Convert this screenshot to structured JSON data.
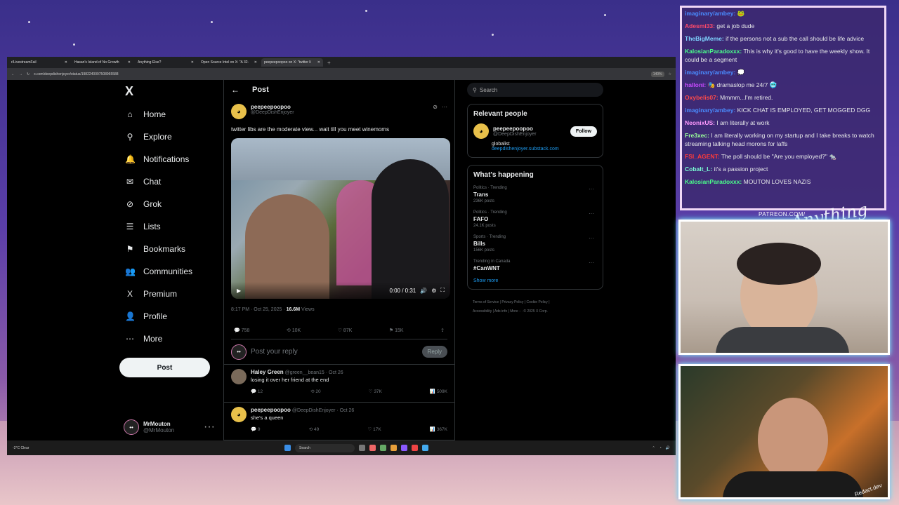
{
  "browser": {
    "tabs": [
      {
        "label": "r/LivestreamFail",
        "active": false
      },
      {
        "label": "Hasan's Island of No Growth",
        "active": false
      },
      {
        "label": "Anything Else?",
        "active": false
      },
      {
        "label": "Open Source Intel on X: \"A 32-",
        "active": false
      },
      {
        "label": "peepeepoopoo on X: \"twitter li",
        "active": true
      }
    ],
    "url": "x.com/deepdishenjoyer/status/1982240097508965588",
    "zoom": "140%"
  },
  "nav": {
    "logo": "X",
    "items": [
      {
        "label": "Home",
        "icon": "home-icon",
        "glyph": "⌂"
      },
      {
        "label": "Explore",
        "icon": "search-icon",
        "glyph": "⚲"
      },
      {
        "label": "Notifications",
        "icon": "bell-icon",
        "glyph": "🔔"
      },
      {
        "label": "Chat",
        "icon": "mail-icon",
        "glyph": "✉"
      },
      {
        "label": "Grok",
        "icon": "grok-icon",
        "glyph": "⊘"
      },
      {
        "label": "Lists",
        "icon": "list-icon",
        "glyph": "☰"
      },
      {
        "label": "Bookmarks",
        "icon": "bookmark-icon",
        "glyph": "⚑"
      },
      {
        "label": "Communities",
        "icon": "people-icon",
        "glyph": "👥"
      },
      {
        "label": "Premium",
        "icon": "x-premium-icon",
        "glyph": "X"
      },
      {
        "label": "Profile",
        "icon": "profile-icon",
        "glyph": "👤"
      },
      {
        "label": "More",
        "icon": "more-circle-icon",
        "glyph": "⋯"
      }
    ],
    "post_label": "Post",
    "account_name": "MrMouton",
    "account_handle": "@MrMouton"
  },
  "main": {
    "header_title": "Post",
    "tweet": {
      "name": "peepeepoopoo",
      "handle": "@DeepDishEnjoyer",
      "text": "twitter libs are the moderate view... wait till you meet winemoms",
      "video_time": "0:00 / 0:31",
      "time": "8:17 PM · Oct 25, 2025 ·",
      "views_count": "16.6M",
      "views_label": "Views",
      "replies": "758",
      "reposts": "10K",
      "likes": "87K",
      "bookmarks": "15K"
    },
    "reply_placeholder": "Post your reply",
    "reply_button": "Reply",
    "replies": [
      {
        "name": "Haley Green",
        "handle": "@green__bean15 · Oct 26",
        "text": "losing it over her friend at the end",
        "replies": "12",
        "reposts": "20",
        "likes": "37K",
        "views": "509K"
      },
      {
        "name": "peepeepoopoo",
        "handle": "@DeepDishEnjoyer · Oct 26",
        "text": "she's a queen",
        "replies": "9",
        "reposts": "49",
        "likes": "17K",
        "views": "367K"
      }
    ]
  },
  "sidebar": {
    "search_placeholder": "Search",
    "relevant_title": "Relevant people",
    "person": {
      "name": "peepeepoopoo",
      "handle": "@DeepDishEnjoyer",
      "bio": "globalist",
      "link": "deepdishenjoyer.substack.com",
      "follow": "Follow"
    },
    "happening_title": "What's happening",
    "trends": [
      {
        "category": "Politics · Trending",
        "title": "Trans",
        "count": "236K posts"
      },
      {
        "category": "Politics · Trending",
        "title": "FAFO",
        "count": "24.1K posts"
      },
      {
        "category": "Sports · Trending",
        "title": "Bills",
        "count": "156K posts"
      },
      {
        "category": "Trending in Canada",
        "title": "#CanWNT",
        "count": ""
      }
    ],
    "show_more": "Show more",
    "footer": [
      "Terms of Service",
      "Privacy Policy",
      "Cookie Policy",
      "Accessibility",
      "Ads info",
      "More ···",
      "© 2025 X Corp."
    ]
  },
  "taskbar": {
    "weather": "-2°C Clear",
    "search": "Search"
  },
  "chat": [
    {
      "user": "imaginary/ambey:",
      "text": "🐸",
      "color": "#4a8cff"
    },
    {
      "user": "Adesmi33:",
      "text": "get a job dude",
      "color": "#ff4a6a"
    },
    {
      "user": "TheBigMeme:",
      "text": "if the persons not a sub the call should be life advice",
      "color": "#7fd4ff"
    },
    {
      "user": "KalosianParadoxxx:",
      "text": "This is why it's good to have the weekly show. It could be a segment",
      "color": "#4aff8a"
    },
    {
      "user": "imaginary/ambey:",
      "text": "💭",
      "color": "#4a8cff"
    },
    {
      "user": "halloni:",
      "text": "🎭 dramaslop me 24/7 🥶",
      "color": "#c84aff"
    },
    {
      "user": "Oxybelis07:",
      "text": "Mmmm...I'm retired.",
      "color": "#ff4a4a"
    },
    {
      "user": "imaginary/ambey:",
      "text": "KICK CHAT IS EMPLOYED, GET MOGGED DGG",
      "color": "#4a8cff"
    },
    {
      "user": "NeonixUS:",
      "text": "I am literally at work",
      "color": "#ff9aff"
    },
    {
      "user": "Fre3xec:",
      "text": "I am literally working on my startup and I take breaks to watch streaming talking head morons for laffs",
      "color": "#9aff9a"
    },
    {
      "user": "FSI_AGENT:",
      "text": "The poll should be \"Are you employed?\" 🐀",
      "color": "#ff3a3a"
    },
    {
      "user": "Cobalt_L:",
      "text": "it's a passion project",
      "color": "#7affd4"
    },
    {
      "user": "KalosianParadoxxx:",
      "text": "MOUTON LOVES NAZIS",
      "color": "#4aff8a"
    }
  ],
  "overlay": {
    "patreon": "PATREON.COM/",
    "brand": "Anything Else?",
    "cam_label": "Redact.dev"
  }
}
